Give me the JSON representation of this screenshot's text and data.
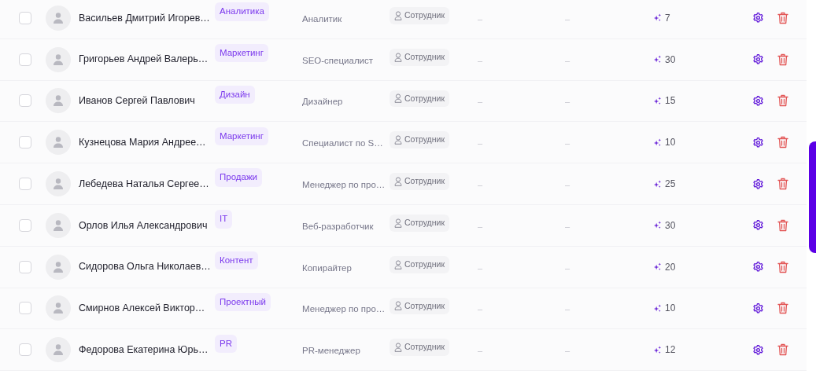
{
  "rows": [
    {
      "checked": false,
      "name": "Васильев Дмитрий Игорев…",
      "department": "Аналитика",
      "position": "Аналитик",
      "role": "Сотрудник",
      "column_6": "–",
      "column_7": "–",
      "points": "7"
    },
    {
      "checked": false,
      "name": "Григорьев Андрей Валерь…",
      "department": "Маркетинг",
      "position": "SEO-специалист",
      "role": "Сотрудник",
      "column_6": "–",
      "column_7": "–",
      "points": "30"
    },
    {
      "checked": false,
      "name": "Иванов Сергей Павлович",
      "department": "Дизайн",
      "position": "Дизайнер",
      "role": "Сотрудник",
      "column_6": "–",
      "column_7": "–",
      "points": "15"
    },
    {
      "checked": false,
      "name": "Кузнецова Мария Андрее…",
      "department": "Маркетинг",
      "position": "Специалист по S…",
      "role": "Сотрудник",
      "column_6": "–",
      "column_7": "–",
      "points": "10"
    },
    {
      "checked": false,
      "name": "Лебедева Наталья Сергее…",
      "department": "Продажи",
      "position": "Менеджер по про…",
      "role": "Сотрудник",
      "column_6": "–",
      "column_7": "–",
      "points": "25"
    },
    {
      "checked": false,
      "name": "Орлов Илья Александрович",
      "department": "IT",
      "position": "Веб-разработчик",
      "role": "Сотрудник",
      "column_6": "–",
      "column_7": "–",
      "points": "30"
    },
    {
      "checked": false,
      "name": "Сидорова Ольга Николаев…",
      "department": "Контент",
      "position": "Копирайтер",
      "role": "Сотрудник",
      "column_6": "–",
      "column_7": "–",
      "points": "20"
    },
    {
      "checked": false,
      "name": "Смирнов Алексей Виктор…",
      "department": "Проектный",
      "position": "Менеджер по про…",
      "role": "Сотрудник",
      "column_6": "–",
      "column_7": "–",
      "points": "10"
    },
    {
      "checked": false,
      "name": "Федорова Екатерина Юрь…",
      "department": "PR",
      "position": "PR-менеджер",
      "role": "Сотрудник",
      "column_6": "–",
      "column_7": "–",
      "points": "12"
    }
  ]
}
